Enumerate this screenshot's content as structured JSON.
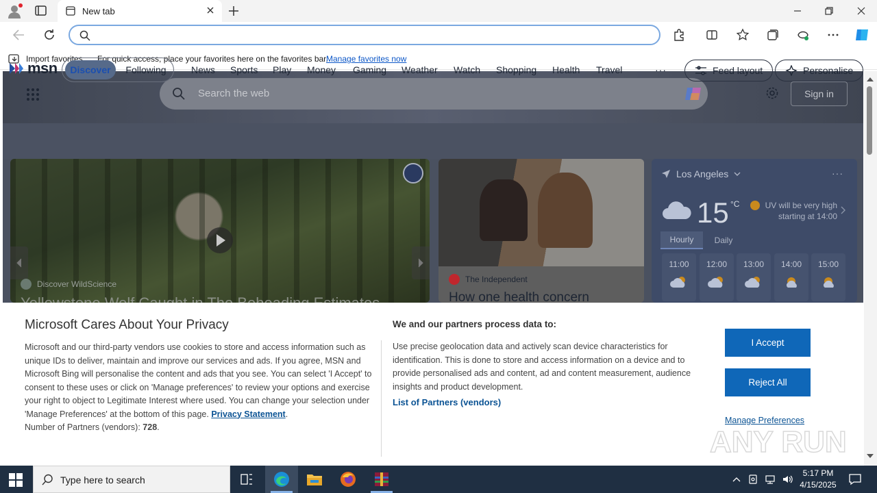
{
  "browser": {
    "tab_title": "New tab",
    "address_value": "",
    "favorites_bar": {
      "import_label": "Import favorites",
      "hint": "For quick access, place your favorites here on the favorites bar.",
      "manage_link": "Manage favorites now"
    }
  },
  "msn": {
    "search_placeholder": "Search the web",
    "sign_in": "Sign in",
    "logo_text": "msn",
    "pills": {
      "discover": "Discover",
      "following": "Following"
    },
    "nav": [
      "News",
      "Sports",
      "Play",
      "Money",
      "Gaming",
      "Weather",
      "Watch",
      "Shopping",
      "Health",
      "Travel"
    ],
    "nav_more": "···",
    "feed_layout": "Feed layout",
    "personalise": "Personalise",
    "hero": {
      "source": "Discover WildScience",
      "title": "Yellowstone Wolf Caught in The Beheading Estimates"
    },
    "card2": {
      "source": "The Independent",
      "title": "How one health concern"
    },
    "weather": {
      "location": "Los Angeles",
      "more": "···",
      "temp": "15",
      "unit": "°C",
      "uv_line1": "UV will be very high",
      "uv_line2": "starting at 14:00",
      "tabs": [
        "Hourly",
        "Daily"
      ],
      "hours": [
        "11:00",
        "12:00",
        "13:00",
        "14:00",
        "15:00"
      ]
    }
  },
  "privacy": {
    "title": "Microsoft Cares About Your Privacy",
    "body": "Microsoft and our third-party vendors use cookies to store and access information such as unique IDs to deliver, maintain and improve our services and ads. If you agree, MSN and Microsoft Bing will personalise the content and ads that you see. You can select 'I Accept' to consent to these uses or click on 'Manage preferences' to review your options and exercise your right to object to Legitimate Interest where used.  You can change your selection under 'Manage Preferences' at the bottom of this page.",
    "privacy_link": "Privacy Statement",
    "partners_count_label": "Number of Partners (vendors):",
    "partners_count": "728",
    "subtitle": "We and our partners process data to:",
    "purpose": "Use precise geolocation data and actively scan device characteristics for identification. This is done to store and access information on a device and to provide personalised ads and content, ad and content measurement, audience insights and product development.",
    "partners_link": "List of Partners (vendors)",
    "accept": "I Accept",
    "reject": "Reject All",
    "manage": "Manage Preferences"
  },
  "watermark_text": "ANY RUN",
  "taskbar": {
    "search_placeholder": "Type here to search",
    "time": "5:17 PM",
    "date": "4/15/2025"
  },
  "colors": {
    "accent_blue": "#0f67b8",
    "link_blue": "#0b5394",
    "taskbar": "#1f2f42"
  }
}
